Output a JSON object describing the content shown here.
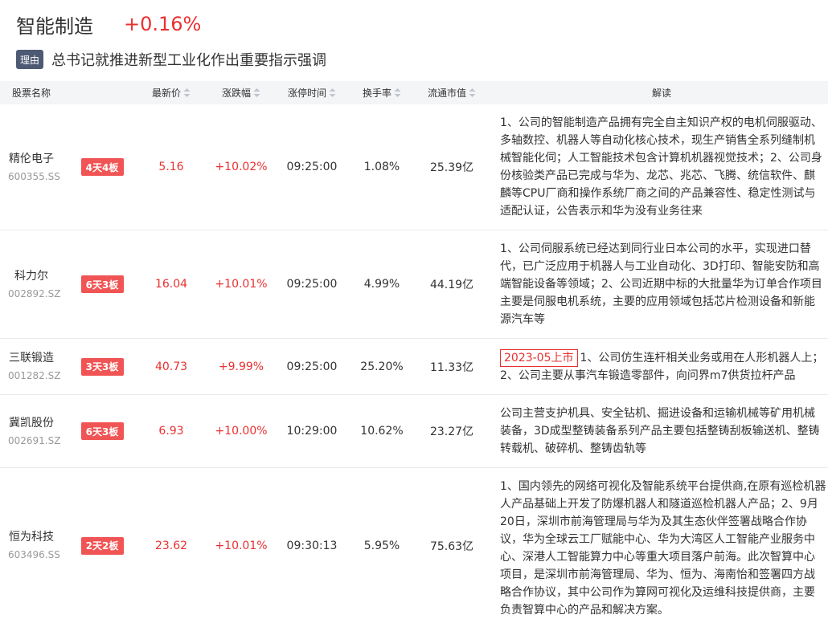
{
  "sector": {
    "name": "智能制造",
    "change": "+0.16%"
  },
  "reason": {
    "tag": "理由",
    "text": "总书记就推进新型工业化作出重要指示强调"
  },
  "colors": {
    "up": "#e93030",
    "badge": "#f05454",
    "reason_tag": "#4e5a74",
    "header_bg": "#f4f5f7"
  },
  "icons": {
    "sort": "sort-icon"
  },
  "table": {
    "headers": {
      "name": "股票名称",
      "price": "最新价",
      "change": "涨跌幅",
      "limit_time": "涨停时间",
      "turnover": "换手率",
      "market_cap": "流通市值",
      "interp": "解读"
    },
    "rows": [
      {
        "name": "精伦电子",
        "code": "600355.SS",
        "streak": "4天4板",
        "price": "5.16",
        "change": "+10.02%",
        "limit_time": "09:25:00",
        "turnover": "1.08%",
        "market_cap": "25.39亿",
        "interp": [
          "1、公司的智能制造产品拥有完全自主知识产权的电机伺服驱动、",
          "多轴数控、机器人等自动化核心技术，现生产销售全系列缝制机",
          "械智能化伺；人工智能技术包含计算机机器视觉技术；2、公司身",
          "份核验类产品已完成与华为、龙芯、兆芯、飞腾、统信软件、麒",
          "麟等CPU厂商和操作系统厂商之间的产品兼容性、稳定性测试与",
          "适配认证，公告表示和华为没有业务往来"
        ]
      },
      {
        "name": "科力尔",
        "code": "002892.SZ",
        "streak": "6天3板",
        "price": "16.04",
        "change": "+10.01%",
        "limit_time": "09:25:00",
        "turnover": "4.99%",
        "market_cap": "44.19亿",
        "interp": [
          "1、公司伺服系统已经达到同行业日本公司的水平，实现进口替",
          "代，已广泛应用于机器人与工业自动化、3D打印、智能安防和高",
          "端智能设备等领域；2、公司近期中标的大批量华为订单合作项目",
          "主要是伺服电机系统，主要的应用领域包括芯片检测设备和新能",
          "源汽车等"
        ]
      },
      {
        "name": "三联锻造",
        "code": "001282.SZ",
        "streak": "3天3板",
        "price": "40.73",
        "change": "+9.99%",
        "limit_time": "09:25:00",
        "turnover": "25.20%",
        "market_cap": "11.33亿",
        "listing_tag": "2023-05上市",
        "interp": [
          "1、公司仿生连杆相关业务或用在人形机器人上；",
          "2、公司主要从事汽车锻造零部件，向问界m7供货拉杆产品"
        ]
      },
      {
        "name": "冀凯股份",
        "code": "002691.SZ",
        "streak": "6天3板",
        "price": "6.93",
        "change": "+10.00%",
        "limit_time": "10:29:00",
        "turnover": "10.62%",
        "market_cap": "23.27亿",
        "interp": [
          "公司主营支护机具、安全钻机、掘进设备和运输机械等矿用机械",
          "装备，3D成型整铸装备系列产品主要包括整铸刮板输送机、整铸",
          "转载机、破碎机、整铸齿轨等"
        ]
      },
      {
        "name": "恒为科技",
        "code": "603496.SS",
        "streak": "2天2板",
        "price": "23.62",
        "change": "+10.01%",
        "limit_time": "09:30:13",
        "turnover": "5.95%",
        "market_cap": "75.63亿",
        "interp": [
          "1、国内领先的网络可视化及智能系统平台提供商,在原有巡检机器",
          "人产品基础上开发了防爆机器人和隧道巡检机器人产品；2、9月",
          "20日，深圳市前海管理局与华为及其生态伙伴签署战略合作协",
          "议，华为全球云工厂赋能中心、华为大湾区人工智能产业服务中",
          "心、深港人工智能算力中心等重大项目落户前海。此次智算中心",
          "项目，是深圳市前海管理局、华为、恒为、海南怡和签署四方战",
          "略合作协议，其中公司作为算网可视化及运维科技提供商，主要",
          "负责智算中心的产品和解决方案。"
        ]
      }
    ]
  }
}
